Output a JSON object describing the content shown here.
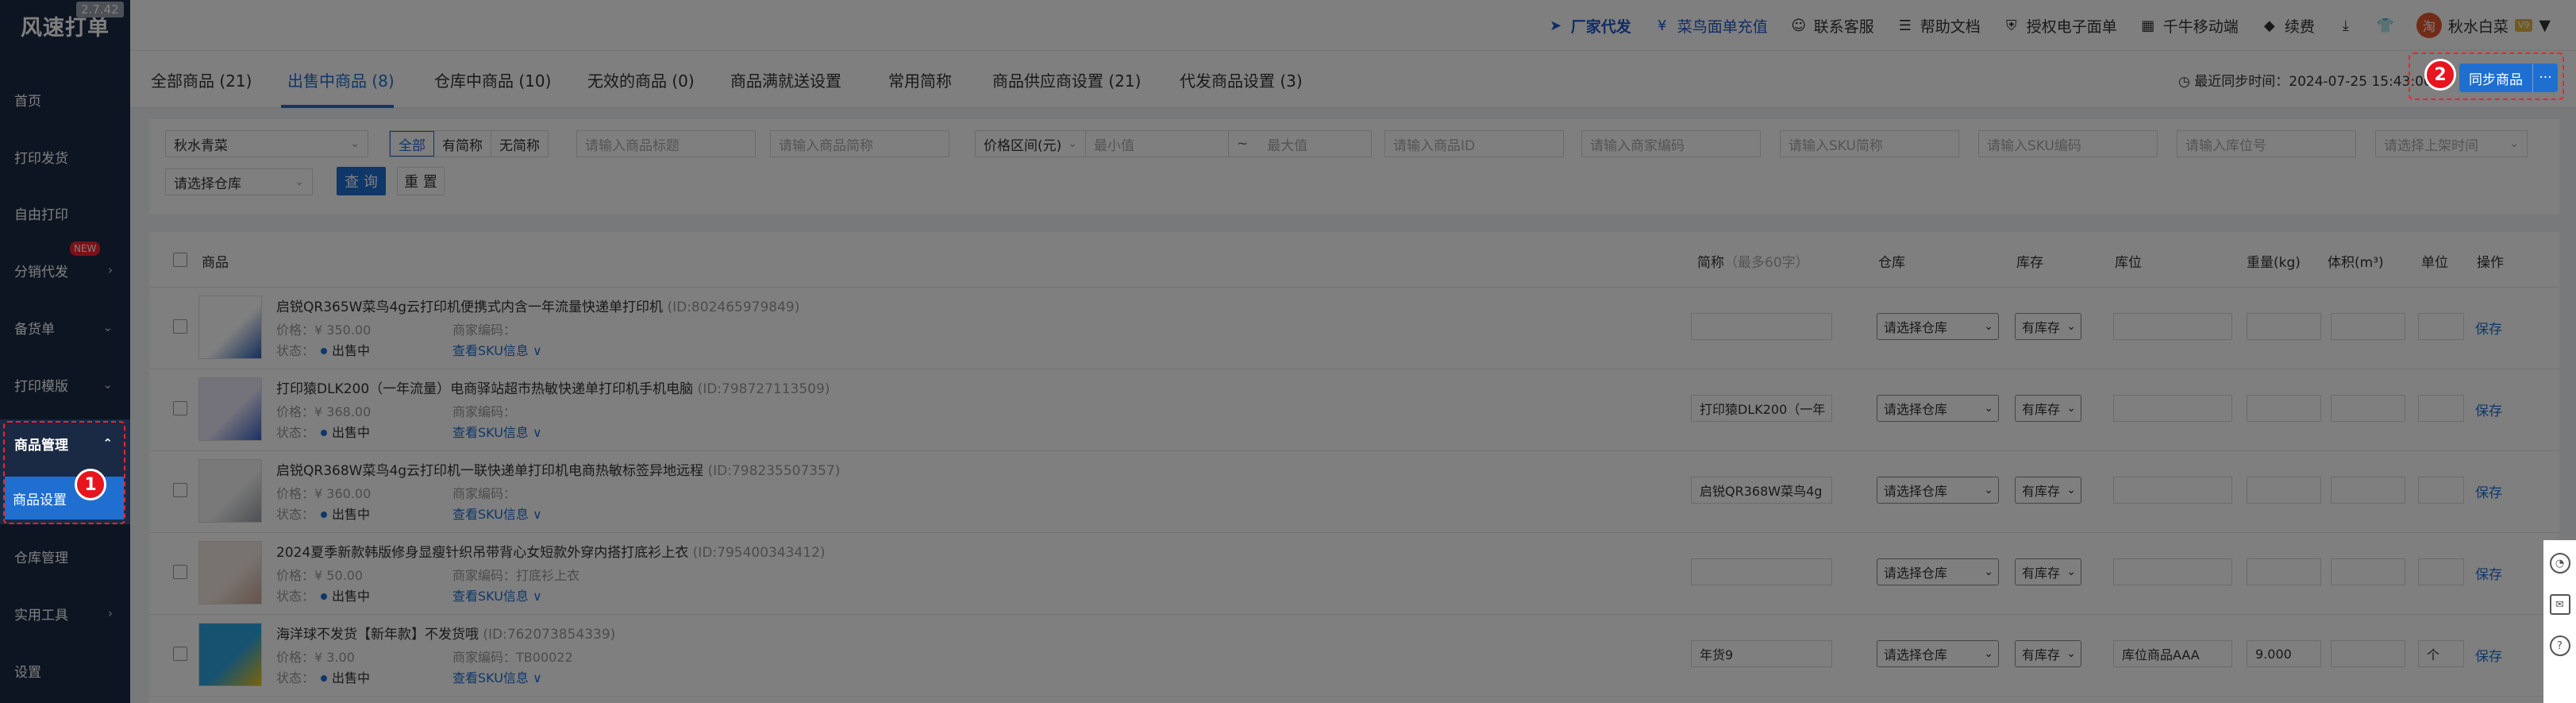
{
  "app": {
    "logo": "风速打单",
    "version": "2.7.42"
  },
  "sidebar": {
    "items": [
      {
        "label": "首页"
      },
      {
        "label": "打印发货"
      },
      {
        "label": "自由打印"
      },
      {
        "label": "分销代发",
        "badge": "NEW"
      },
      {
        "label": "备货单"
      },
      {
        "label": "打印模版"
      },
      {
        "label": "商品管理"
      },
      {
        "label": "商品设置"
      },
      {
        "label": "仓库管理"
      },
      {
        "label": "实用工具"
      },
      {
        "label": "设置"
      }
    ]
  },
  "topbar": {
    "items": [
      {
        "label": "厂家代发",
        "icon": "send-icon"
      },
      {
        "label": "菜鸟面单充值",
        "icon": "yen-icon"
      },
      {
        "label": "联系客服",
        "icon": "chat-icon"
      },
      {
        "label": "帮助文档",
        "icon": "doc-icon"
      },
      {
        "label": "授权电子面单",
        "icon": "shield-icon"
      },
      {
        "label": "千牛移动端",
        "icon": "grid-icon"
      },
      {
        "label": "续费",
        "icon": "gem-icon"
      }
    ],
    "user": {
      "name": "秋水白菜",
      "avatar_text": "淘",
      "vip": "V9"
    }
  },
  "tabs": [
    {
      "label": "全部商品 (21)"
    },
    {
      "label": "出售中商品 (8)"
    },
    {
      "label": "仓库中商品 (10)"
    },
    {
      "label": "无效的商品 (0)"
    },
    {
      "label": "商品满就送设置"
    },
    {
      "label": "常用简称"
    },
    {
      "label": "商品供应商设置 (21)"
    },
    {
      "label": "代发商品设置 (3)"
    }
  ],
  "sync": {
    "time_label": "最近同步时间：2024-07-25 15:43:00",
    "button": "同步商品",
    "more": "···"
  },
  "steps": {
    "one": "1",
    "two": "2"
  },
  "filters": {
    "shop": "秋水青菜",
    "seg": [
      "全部",
      "有简称",
      "无简称"
    ],
    "title_ph": "请输入商品标题",
    "short_ph": "请输入商品简称",
    "price_sel": "价格区间(元)",
    "min_ph": "最小值",
    "to": "~",
    "max_ph": "最大值",
    "id_ph": "请输入商品ID",
    "code_ph": "请输入商家编码",
    "skuname_ph": "请输入SKU简称",
    "skucode_ph": "请输入SKU编码",
    "loc_ph": "请输入库位号",
    "onsale_ph": "请选择上架时间",
    "warehouse_ph": "请选择仓库",
    "query": "查 询",
    "reset": "重 置"
  },
  "table": {
    "headers": {
      "product": "商品",
      "short": "简称",
      "short_hint": "（最多60字）",
      "warehouse": "仓库",
      "stock": "库存",
      "location": "库位",
      "weight": "重量(kg)",
      "volume": "体积(m³)",
      "unit": "单位",
      "action": "操作"
    },
    "price_label": "价格：",
    "code_label": "商家编码：",
    "status_label": "状态：",
    "sku_link": "查看SKU信息 ∨",
    "save": "保存",
    "wh_default": "请选择仓库",
    "stock_default": "有库存",
    "rows": [
      {
        "title": "启锐QR365W菜鸟4g云打印机便携式内含一年流量快递单打印机",
        "id": "(ID:802465979849)",
        "price": "¥ 350.00",
        "code": "",
        "status": "出售中",
        "short": "",
        "location": "",
        "weight": "",
        "volume": "",
        "unit": ""
      },
      {
        "title": "打印猿DLK200（一年流量）电商驿站超市热敏快递单打印机手机电脑",
        "id": "(ID:798727113509)",
        "price": "¥ 368.00",
        "code": "",
        "status": "出售中",
        "short": "打印猿DLK200（一年",
        "location": "",
        "weight": "",
        "volume": "",
        "unit": ""
      },
      {
        "title": "启锐QR368W菜鸟4g云打印机一联快递单打印机电商热敏标签异地远程",
        "id": "(ID:798235507357)",
        "price": "¥ 360.00",
        "code": "",
        "status": "出售中",
        "short": "启锐QR368W菜鸟4g",
        "location": "",
        "weight": "",
        "volume": "",
        "unit": ""
      },
      {
        "title": "2024夏季新款韩版修身显瘦针织吊带背心女短款外穿内搭打底衫上衣",
        "id": "(ID:795400343412)",
        "price": "¥ 50.00",
        "code": "打底衫上衣",
        "status": "出售中",
        "short": "",
        "location": "",
        "weight": "",
        "volume": "",
        "unit": ""
      },
      {
        "title": "海洋球不发货【新年款】不发货哦",
        "id": "(ID:762073854339)",
        "price": "¥ 3.00",
        "code": "TB00022",
        "status": "出售中",
        "short": "年货9",
        "location": "库位商品AAA",
        "weight": "9.000",
        "volume": "",
        "unit": "个"
      }
    ]
  }
}
